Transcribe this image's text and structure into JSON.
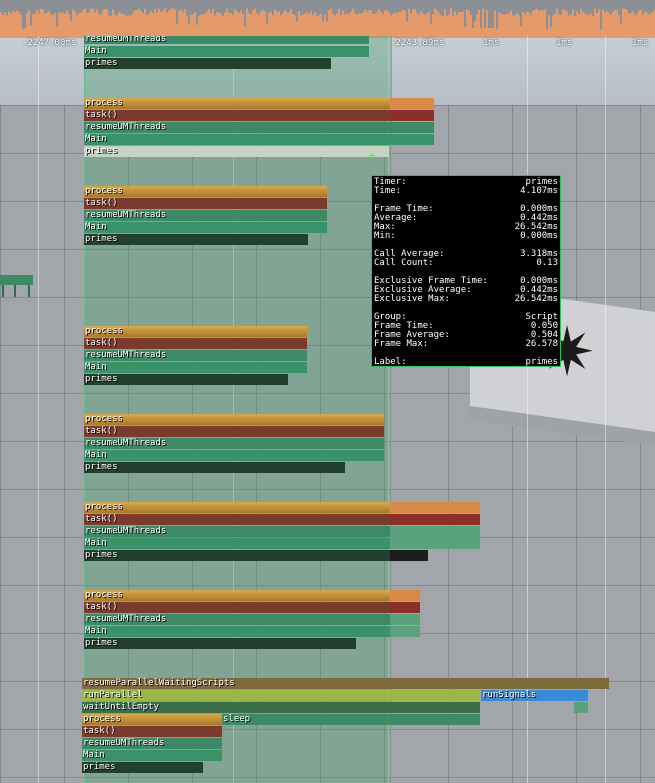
{
  "timeline": {
    "labels": [
      "-2247.00ms",
      "-2243.89ms",
      "1ms",
      "1ms",
      "1ms"
    ]
  },
  "colors": {
    "fps_bar": "#e49a6a",
    "process": "#d8a848",
    "task": "#7a3a2c",
    "resume": "#3f8a66",
    "primes": "#23402d",
    "tooltip_border": "#2fbf5f",
    "run_signals": "#3a8ad8"
  },
  "groups": [
    {
      "labels": [
        "resumeUMThreads",
        "Main",
        "primes"
      ]
    },
    {
      "labels": [
        "process",
        "task()",
        "resumeUMThreads",
        "Main",
        "primes"
      ]
    },
    {
      "labels": [
        "process",
        "task()",
        "resumeUMThreads",
        "Main",
        "primes"
      ]
    },
    {
      "labels": [
        "process",
        "task()",
        "resumeUMThreads",
        "Main",
        "primes"
      ]
    },
    {
      "labels": [
        "process",
        "task()",
        "resumeUMThreads",
        "Main",
        "primes"
      ]
    },
    {
      "labels": [
        "process",
        "task()",
        "resumeUMThreads",
        "Main",
        "primes"
      ]
    },
    {
      "labels": [
        "process",
        "task()",
        "resumeUMThreads",
        "Main",
        "primes"
      ]
    }
  ],
  "bottom": {
    "resume_parallel": "resumeParallelWaitingScripts",
    "run_parallel": "runParallel",
    "run_signals": "runSignals",
    "wait_until_empty": "waitUntilEmpty",
    "sleep": "sleep",
    "process": "process",
    "task": "task()",
    "resume": "resumeUMThreads",
    "main": "Main",
    "primes": "primes"
  },
  "tooltip": {
    "rows": [
      {
        "k": "Timer:",
        "v": "primes"
      },
      {
        "k": "Time:",
        "v": "4.107ms"
      },
      null,
      {
        "k": "Frame Time:",
        "v": "0.000ms"
      },
      {
        "k": "Average:",
        "v": "0.442ms"
      },
      {
        "k": "Max:",
        "v": "26.542ms"
      },
      {
        "k": "Min:",
        "v": "0.000ms"
      },
      null,
      {
        "k": "Call Average:",
        "v": "3.318ms"
      },
      {
        "k": "Call Count:",
        "v": "0.13"
      },
      null,
      {
        "k": "Exclusive Frame Time:",
        "v": "0.000ms"
      },
      {
        "k": "Exclusive Average:",
        "v": "0.442ms"
      },
      {
        "k": "Exclusive Max:",
        "v": "26.542ms"
      },
      null,
      {
        "k": "Group:",
        "v": "Script"
      },
      {
        "k": "Frame Time:",
        "v": "0.050"
      },
      {
        "k": "Frame Average:",
        "v": "0.504"
      },
      {
        "k": "Frame Max:",
        "v": "26.578"
      },
      null,
      {
        "k": "Label:",
        "v": "primes"
      }
    ]
  }
}
